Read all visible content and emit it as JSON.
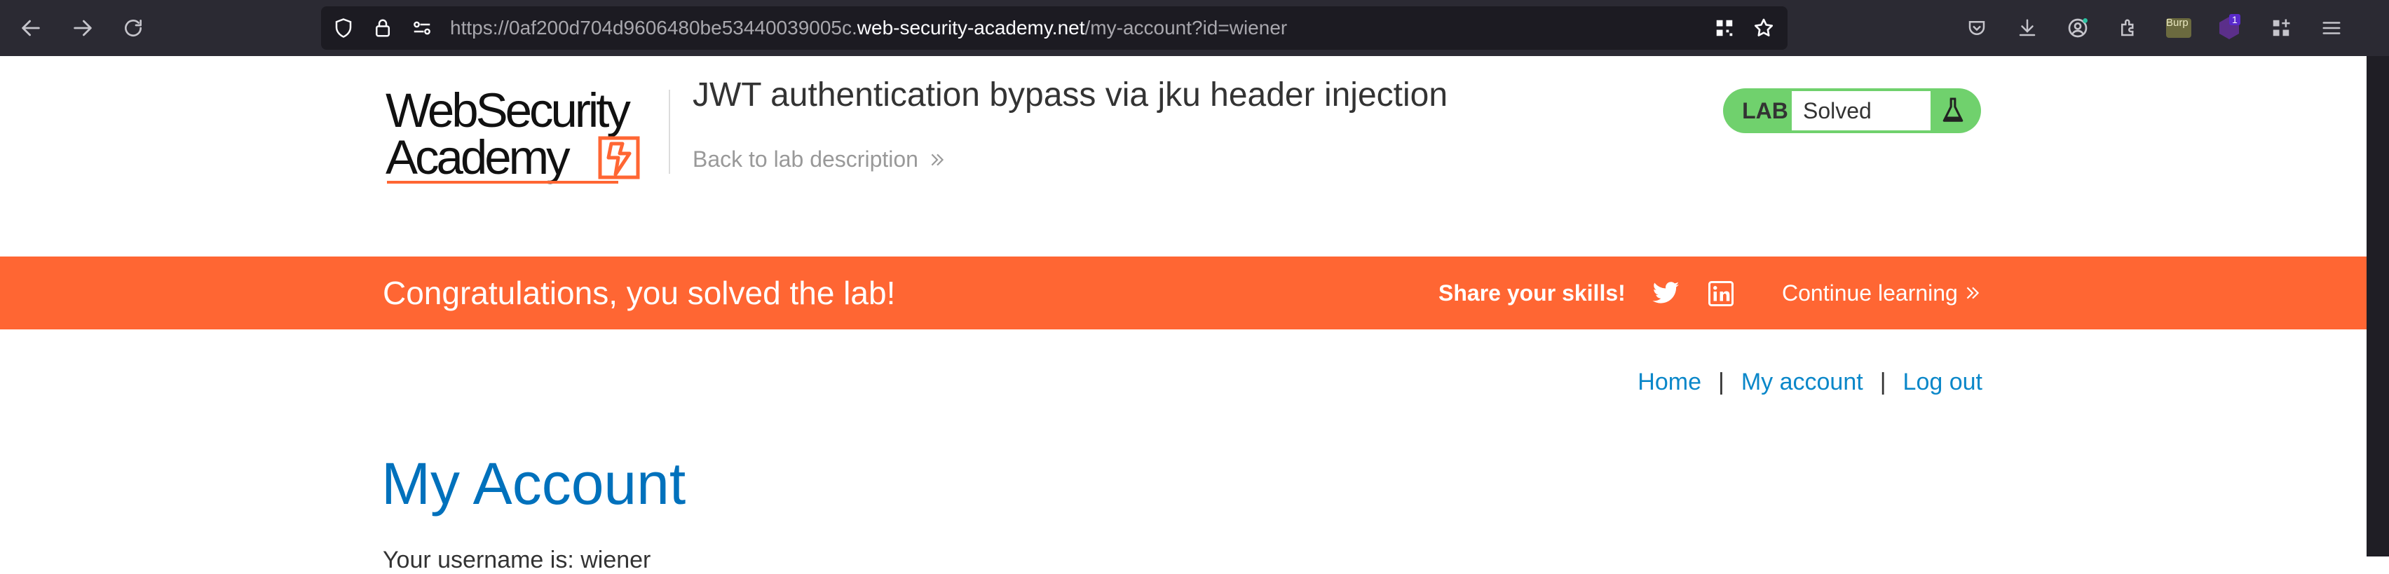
{
  "browser": {
    "url_prefix": "https://0af200d704d9606480be53440039005c.",
    "url_host": "web-security-academy.net",
    "url_path": "/my-account?id=wiener",
    "extension_label": "Burp",
    "notification_count": "1"
  },
  "header": {
    "logo_line1": "WebSecurity",
    "logo_line2": "Academy",
    "lab_title": "JWT authentication bypass via jku header injection",
    "back_link": "Back to lab description",
    "badge_label": "LAB",
    "badge_status": "Solved",
    "badge_color": "#70d16d"
  },
  "banner": {
    "message": "Congratulations, you solved the lab!",
    "share_label": "Share your skills!",
    "continue_label": "Continue learning",
    "color": "#ff6633"
  },
  "nav": {
    "home": "Home",
    "my_account": "My account",
    "log_out": "Log out",
    "separator": "|"
  },
  "main": {
    "title": "My Account",
    "partial_text": "Your username is: wiener"
  },
  "colors": {
    "link": "#0a87c9",
    "title": "#0071bc",
    "chrome_bg": "#2b2a33"
  }
}
